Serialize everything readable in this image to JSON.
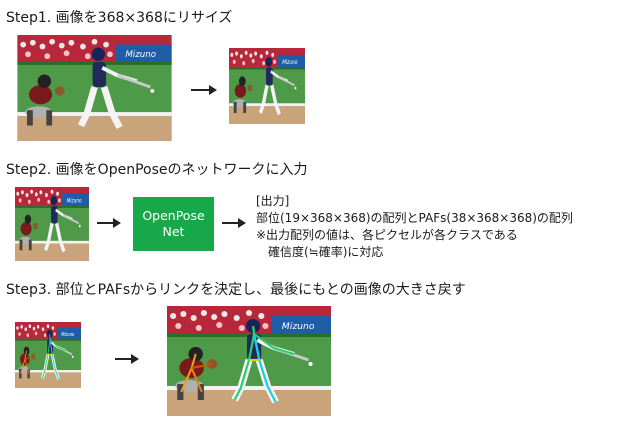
{
  "steps": {
    "step1": {
      "title": "Step1. 画像を368×368にリサイズ"
    },
    "step2": {
      "title": "Step2. 画像をOpenPoseのネットワークに入力"
    },
    "step3": {
      "title": "Step3. 部位とPAFsからリンクを決定し、最後にもとの画像の大きさ戻す"
    }
  },
  "network": {
    "line1": "OpenPose",
    "line2": "Net"
  },
  "output": {
    "heading": "[出力]",
    "line1": "部位(19×368×368)の配列とPAFs(38×368×368)の配列",
    "line2": "※出力配列の値は、各ピクセルが各クラスである",
    "line3": "確信度(≒確率)に対応"
  },
  "colors": {
    "network_box": "#18a84a",
    "arrow": "#222222",
    "pose_green": "#2ecc71",
    "pose_cyan": "#1ad1e0"
  }
}
